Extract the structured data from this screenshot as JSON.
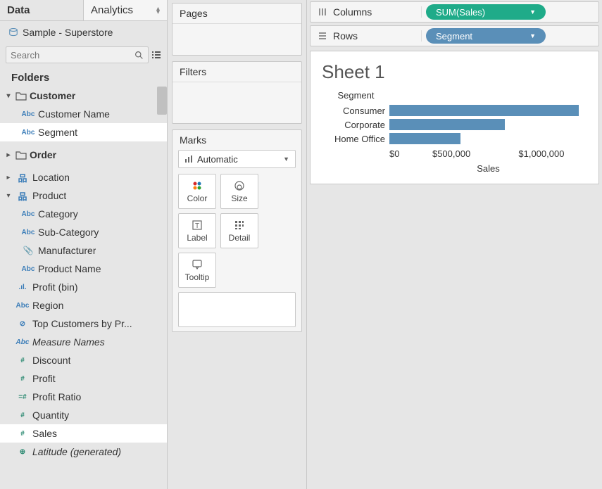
{
  "tabs": {
    "data": "Data",
    "analytics": "Analytics"
  },
  "datasource": "Sample - Superstore",
  "search": {
    "placeholder": "Search"
  },
  "folders_label": "Folders",
  "tree": {
    "customer": "Customer",
    "customer_name": "Customer Name",
    "segment": "Segment",
    "order": "Order",
    "location": "Location",
    "product": "Product",
    "category": "Category",
    "sub_category": "Sub-Category",
    "manufacturer": "Manufacturer",
    "product_name": "Product Name",
    "profit_bin": "Profit (bin)",
    "region": "Region",
    "top_customers": "Top Customers by Pr...",
    "measure_names": "Measure Names",
    "discount": "Discount",
    "profit": "Profit",
    "profit_ratio": "Profit Ratio",
    "quantity": "Quantity",
    "sales": "Sales",
    "latitude": "Latitude (generated)"
  },
  "shelves": {
    "pages": "Pages",
    "filters": "Filters",
    "marks": "Marks",
    "marks_type": "Automatic",
    "color": "Color",
    "size": "Size",
    "label": "Label",
    "detail": "Detail",
    "tooltip": "Tooltip"
  },
  "columns": {
    "label": "Columns",
    "pill": "SUM(Sales)"
  },
  "rows": {
    "label": "Rows",
    "pill": "Segment"
  },
  "sheet_title": "Sheet 1",
  "chart_data": {
    "type": "bar",
    "title": "Sheet 1",
    "segment_label": "Segment",
    "categories": [
      "Consumer",
      "Corporate",
      "Home Office"
    ],
    "values": [
      1150000,
      700000,
      430000
    ],
    "xlabel": "Sales",
    "ylabel": "Segment",
    "xlim": [
      0,
      1200000
    ],
    "xticks": [
      "$0",
      "$500,000",
      "$1,000,000"
    ]
  }
}
